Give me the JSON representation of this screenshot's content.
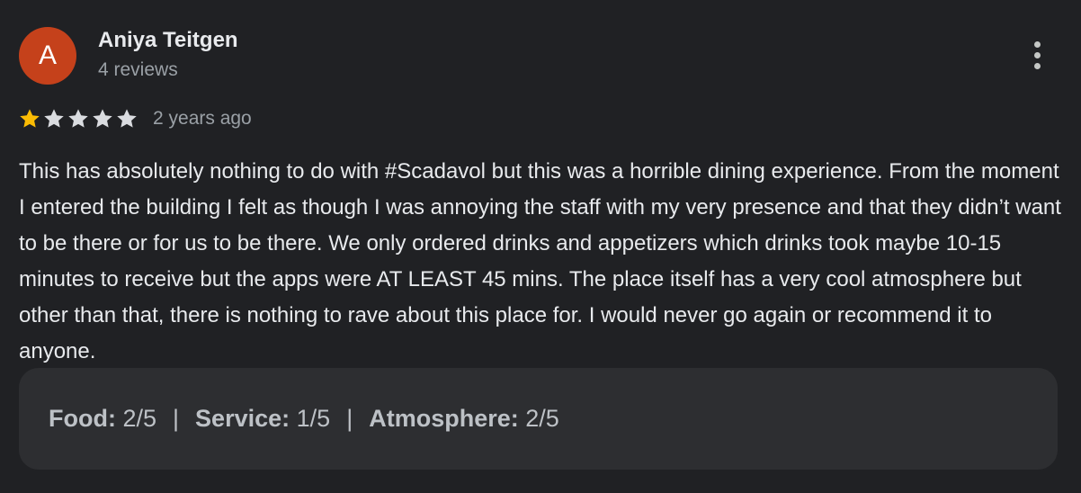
{
  "author": {
    "name": "Aniya Teitgen",
    "initial": "A",
    "avatar_color": "#c5411b",
    "review_count": "4 reviews"
  },
  "rating": {
    "stars": 1,
    "max_stars": 5,
    "filled_color": "#fbbc04",
    "empty_color": "#dadce0",
    "date": "2 years ago"
  },
  "review_text": "This has absolutely nothing to do with #Scadavol but this was a horrible dining experience. From the moment I entered the building I felt as though I was annoying the staff with my very presence and that they didn’t want to be there or for us to be there. We only ordered drinks and appetizers which drinks took maybe 10-15 minutes to receive but the apps were AT LEAST 45 mins. The place itself has a very cool atmosphere but other than that, there is nothing to rave about this place for. I would never go again or recommend it to anyone.",
  "attributes": [
    {
      "label": "Food:",
      "value": "2/5"
    },
    {
      "label": "Service:",
      "value": "1/5"
    },
    {
      "label": "Atmosphere:",
      "value": "2/5"
    }
  ],
  "separator": "|",
  "icons": {
    "more": "more-vert-icon",
    "star": "star-icon"
  }
}
